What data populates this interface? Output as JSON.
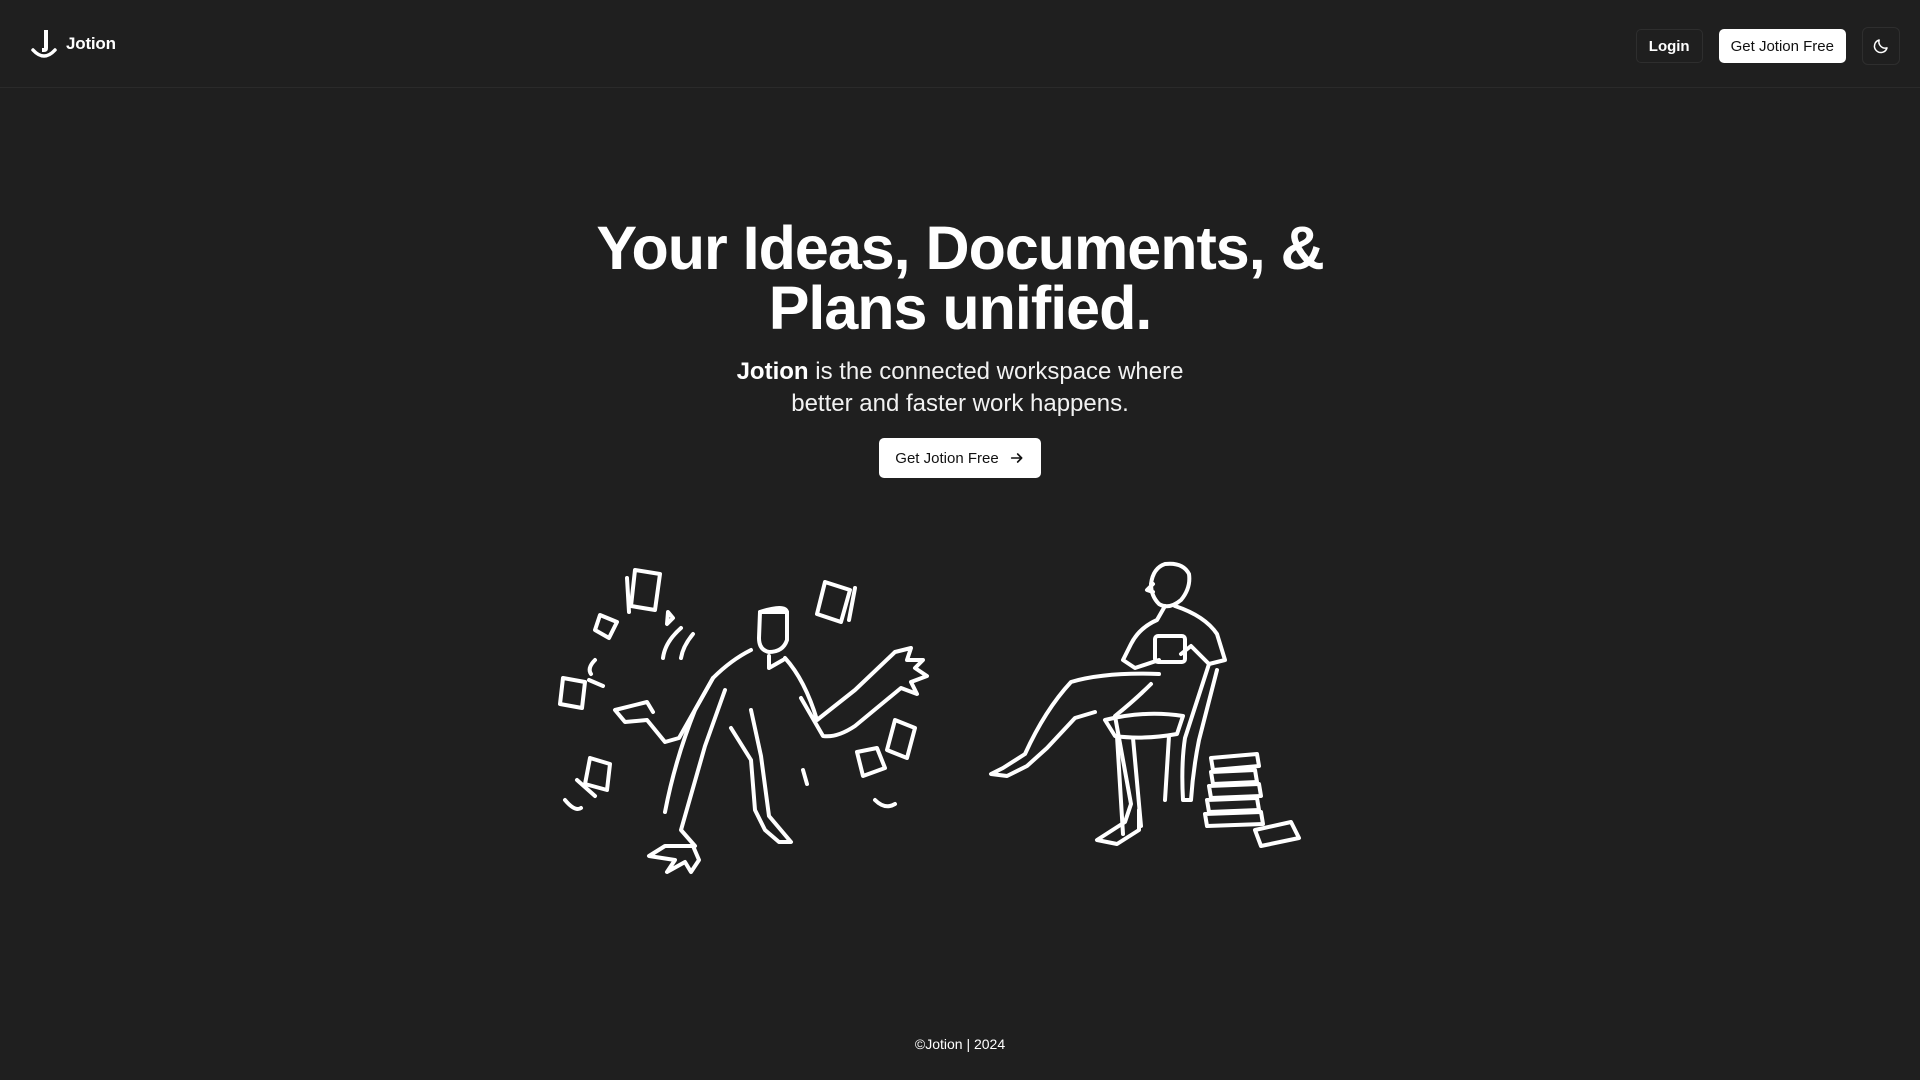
{
  "nav": {
    "brand_name": "Jotion",
    "login_label": "Login",
    "get_free_label": "Get Jotion Free",
    "theme_icon": "moon-icon"
  },
  "hero": {
    "headline_line1": "Your Ideas, Documents, &",
    "headline_line2": "Plans unified.",
    "sub_brand": "Jotion",
    "sub_rest_line1": " is the connected workspace where",
    "sub_line2": "better and faster work happens.",
    "cta_label": "Get Jotion Free",
    "cta_icon": "arrow-right-icon"
  },
  "footer": {
    "copyright": "©Jotion | 2024"
  },
  "colors": {
    "background": "#1f1f1f",
    "foreground": "#ffffff",
    "button_bg": "#ffffff",
    "button_text": "#111111"
  }
}
